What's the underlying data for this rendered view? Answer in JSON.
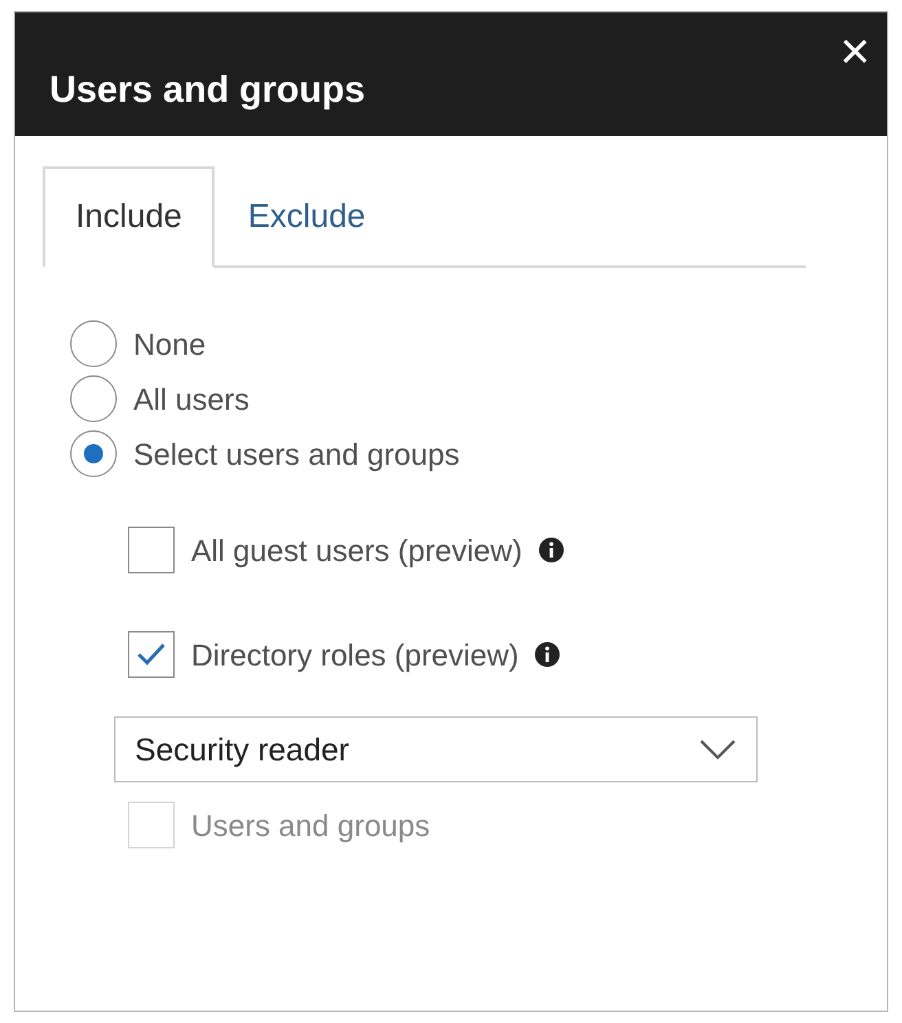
{
  "window": {
    "title": "Users and groups",
    "close": "×"
  },
  "tabs": [
    {
      "label": "Include",
      "selected": true
    },
    {
      "label": "Exclude",
      "selected": false
    }
  ],
  "radios": [
    {
      "label": "None",
      "selected": false
    },
    {
      "label": "All users",
      "selected": false
    },
    {
      "label": "Select users and groups",
      "selected": true
    }
  ],
  "options": [
    {
      "label": "All guest users (preview)",
      "checked": false,
      "disabled": false,
      "info": true
    },
    {
      "label": "Directory roles (preview)",
      "checked": true,
      "disabled": false,
      "info": true
    }
  ],
  "dropdown": {
    "value": "Security reader"
  },
  "extra_options": [
    {
      "label": "Users and groups",
      "checked": false,
      "disabled": true,
      "info": false
    }
  ]
}
